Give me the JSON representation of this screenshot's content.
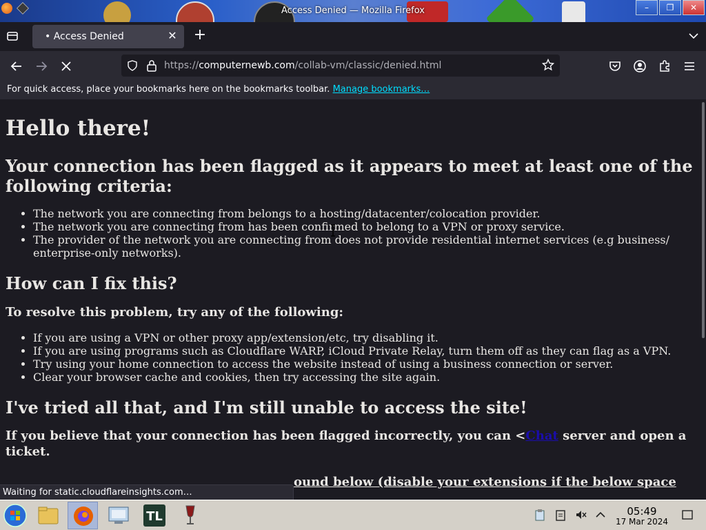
{
  "window": {
    "title": "Access Denied — Mozilla Firefox",
    "minimize_icon": "minimize-icon",
    "maximize_icon": "maximize-icon",
    "close_icon": "close-icon"
  },
  "tabs": [
    {
      "label": "• Access Denied",
      "active": true
    }
  ],
  "navbar": {
    "url_scheme": "https://",
    "url_host": "computernewb.com",
    "url_path": "/collab-vm/classic/denied.html"
  },
  "bookmarks_bar": {
    "message": "For quick access, place your bookmarks here on the bookmarks toolbar.",
    "link": "Manage bookmarks…"
  },
  "page": {
    "hello": "Hello there!",
    "criteria_heading": "Your connection has been flagged as it appears to meet at least one of the following criteria:",
    "criteria": [
      "The network you are connecting from belongs to a hosting/datacenter/colocation provider.",
      "The network you are connecting from has been confirmed to belong to a VPN or proxy service.",
      "The provider of the network you are connecting from does not provide residential internet services (e.g business/ enterprise-only networks)."
    ],
    "fix_heading": "How can I fix this?",
    "resolve_heading": "To resolve this problem, try any of the following:",
    "fixes": [
      "If you are using a VPN or other proxy app/extension/etc, try disabling it.",
      "If you are using programs such as Cloudflare WARP, iCloud Private Relay, turn them off as they can flag as a VPN.",
      "Try using your home connection to access the website instead of using a business connection or server.",
      "Clear your browser cache and cookies, then try accessing the site again."
    ],
    "tried_heading": "I've tried all that, and I'm still unable to access the site!",
    "believe_before": "If you believe that your connection has been flagged incorrectly, you can <",
    "believe_link": "Chat",
    "believe_after": " server and open a ticket.",
    "partial_line": "ound below (disable your extensions if the below space"
  },
  "status": {
    "text": "Waiting for static.cloudflareinsights.com…"
  },
  "taskbar": {
    "items": [
      "start-orb",
      "file-explorer",
      "firefox",
      "control-panel",
      "tl-app",
      "wine-app"
    ],
    "tl_label": "TL",
    "time": "05:49",
    "date": "17 Mar 2024"
  },
  "colors": {
    "page_bg": "#1c1b22",
    "toolbar_bg": "#2b2a33",
    "link": "#00ddff",
    "chat_link": "#1a0dab",
    "text": "#e8e6e3"
  }
}
